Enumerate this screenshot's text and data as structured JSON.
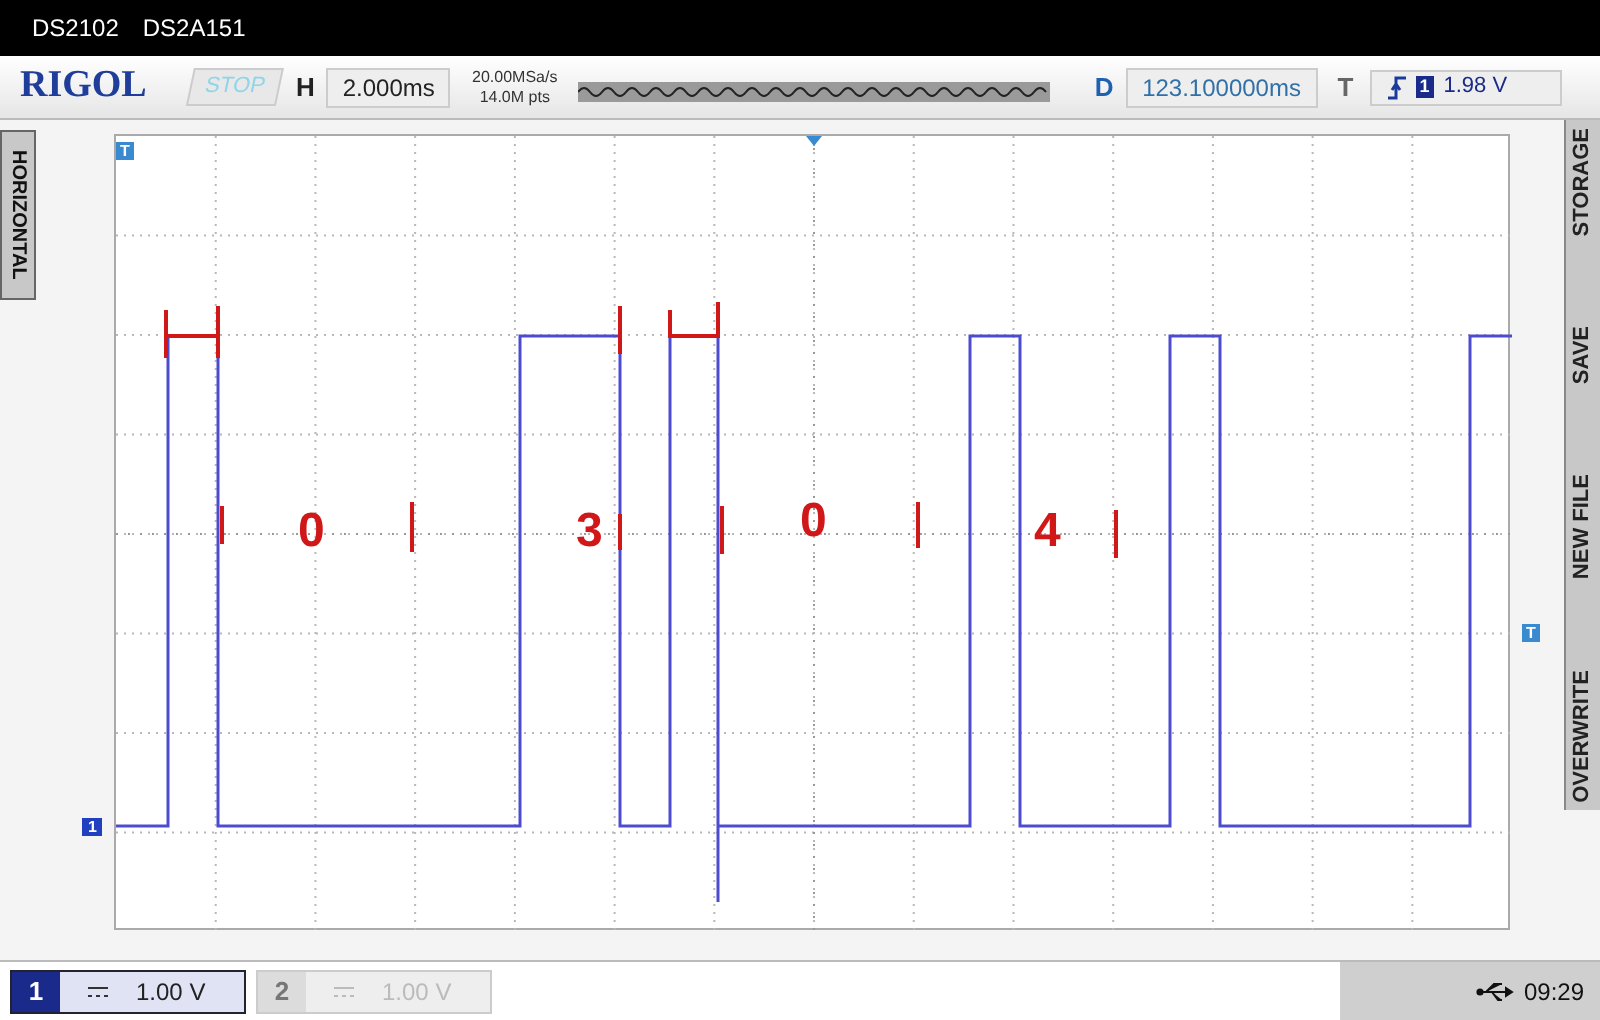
{
  "title_bar": {
    "model": "DS2102",
    "serial": "DS2A151"
  },
  "toolbar": {
    "logo": "RIGOL",
    "run_state": "STOP",
    "h_label": "H",
    "timebase": "2.000ms",
    "sample_rate": "20.00MSa/s",
    "memory_depth": "14.0M pts",
    "d_label": "D",
    "delay": "123.100000ms",
    "t_label": "T",
    "trigger_source": "1",
    "trigger_level": "1.98 V"
  },
  "left_tab": "HORIZONTAL",
  "side_menu": [
    "STORAGE",
    "SAVE",
    "NEW FILE",
    "OVERWRITE"
  ],
  "markers": {
    "trigger_position": "T",
    "trigger_level": "T",
    "channel": "1"
  },
  "annotations": [
    {
      "label": "0"
    },
    {
      "label": "3"
    },
    {
      "label": "0"
    },
    {
      "label": "4"
    }
  ],
  "channels": [
    {
      "number": "1",
      "scale": "1.00 V",
      "enabled": true
    },
    {
      "number": "2",
      "scale": "1.00 V",
      "enabled": false
    }
  ],
  "status": {
    "time": "09:29"
  }
}
